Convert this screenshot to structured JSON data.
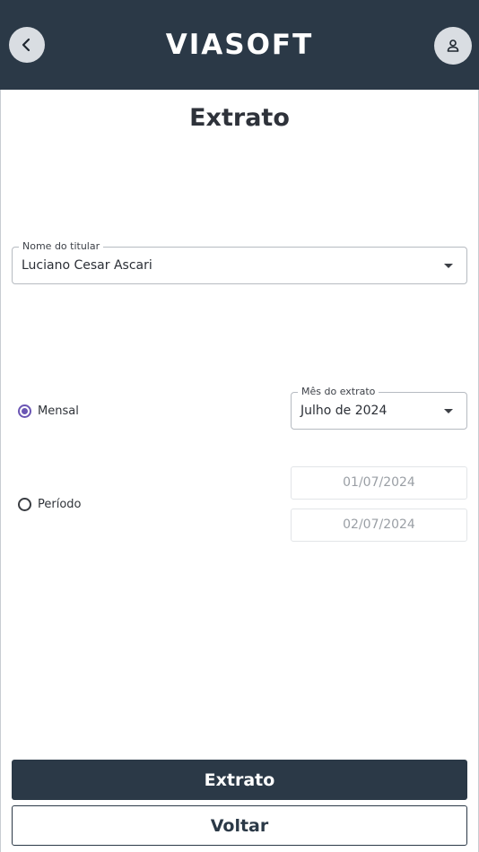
{
  "header": {
    "logo_text": "VIASOFT",
    "back_icon": "chevron-left-icon",
    "user_icon": "user-icon"
  },
  "page": {
    "title": "Extrato"
  },
  "holder_field": {
    "label": "Nome do titular",
    "value": "Luciano Cesar Ascari"
  },
  "mode": {
    "monthly_label": "Mensal",
    "period_label": "Período",
    "selected": "monthly"
  },
  "month_field": {
    "label": "Mês do extrato",
    "value": "Julho de 2024"
  },
  "period": {
    "start_date": "01/07/2024",
    "end_date": "02/07/2024"
  },
  "actions": {
    "primary_label": "Extrato",
    "secondary_label": "Voltar"
  },
  "colors": {
    "header_bg": "#2b3947",
    "accent": "#6b56b4"
  }
}
